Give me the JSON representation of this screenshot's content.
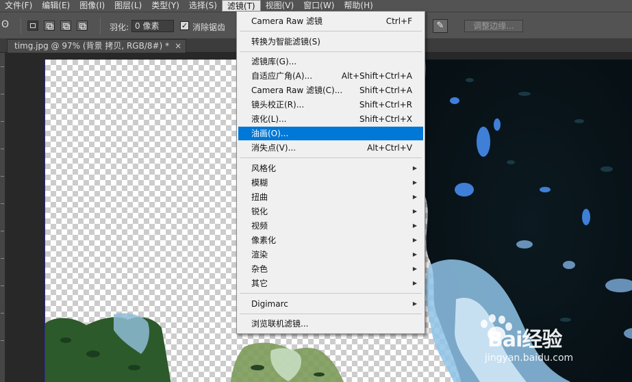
{
  "menu": [
    "文件(F)",
    "编辑(E)",
    "图像(I)",
    "图层(L)",
    "类型(Y)",
    "选择(S)",
    "滤镜(T)",
    "视图(V)",
    "窗口(W)",
    "帮助(H)"
  ],
  "options": {
    "feather_label": "羽化:",
    "feather_value": "0 像素",
    "antialias_label": "消除锯齿",
    "antialias_checked": true,
    "refine_edge_label": "调整边缘..."
  },
  "document_tab": {
    "title": "timg.jpg @ 97% (背景 拷贝, RGB/8#) *",
    "close": "×"
  },
  "filter_menu": {
    "items": [
      {
        "label": "Camera Raw 滤镜",
        "shortcut": "Ctrl+F"
      },
      {
        "label": "转换为智能滤镜(S)",
        "shortcut": ""
      },
      {
        "label": "滤镜库(G)...",
        "shortcut": ""
      },
      {
        "label": "自适应广角(A)...",
        "shortcut": "Alt+Shift+Ctrl+A"
      },
      {
        "label": "Camera Raw 滤镜(C)...",
        "shortcut": "Shift+Ctrl+A"
      },
      {
        "label": "镜头校正(R)...",
        "shortcut": "Shift+Ctrl+R"
      },
      {
        "label": "液化(L)...",
        "shortcut": "Shift+Ctrl+X"
      },
      {
        "label": "油画(O)...",
        "shortcut": "",
        "highlighted": true
      },
      {
        "label": "消失点(V)...",
        "shortcut": "Alt+Ctrl+V"
      },
      {
        "label": "风格化",
        "submenu": true
      },
      {
        "label": "模糊",
        "submenu": true
      },
      {
        "label": "扭曲",
        "submenu": true
      },
      {
        "label": "锐化",
        "submenu": true
      },
      {
        "label": "视频",
        "submenu": true
      },
      {
        "label": "像素化",
        "submenu": true
      },
      {
        "label": "渲染",
        "submenu": true
      },
      {
        "label": "杂色",
        "submenu": true
      },
      {
        "label": "其它",
        "submenu": true
      },
      {
        "label": "Digimarc",
        "submenu": true
      },
      {
        "label": "浏览联机滤镜...",
        "shortcut": ""
      }
    ]
  },
  "watermark": {
    "brand": "Bai经验",
    "url": "jingyan.baidu.com"
  },
  "colors": {
    "menu_highlight": "#0078d7",
    "ui_panel": "#535353",
    "canvas_bg": "#282828"
  }
}
